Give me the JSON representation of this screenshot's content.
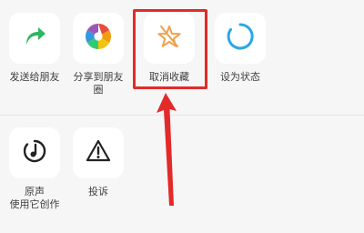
{
  "share_panel": {
    "row1": [
      {
        "label": "发送给朋友",
        "icon": "forward-arrow-icon"
      },
      {
        "label_line1": "分享到朋友",
        "label_line2": "圈",
        "icon": "moments-aperture-icon"
      },
      {
        "label": "取消收藏",
        "icon": "star-slash-icon"
      },
      {
        "label": "设为状态",
        "icon": "status-ring-icon"
      }
    ],
    "row2": [
      {
        "label": "原声",
        "label_line2": "使用它创作",
        "icon": "music-note-icon"
      },
      {
        "label": "投诉",
        "icon": "warning-triangle-icon"
      }
    ]
  },
  "colors": {
    "forward_green": "#2db761",
    "star_orange": "#f0a04b",
    "status_blue": "#29a7e7",
    "highlight_red": "#e32a2a"
  }
}
